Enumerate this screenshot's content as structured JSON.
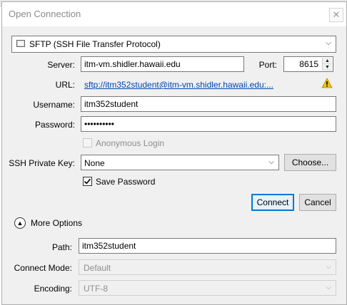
{
  "dialog": {
    "title": "Open Connection",
    "close_glyph": "✕"
  },
  "protocol": {
    "selected": "SFTP (SSH File Transfer Protocol)",
    "icon": "network-drive-icon"
  },
  "server": {
    "label": "Server:",
    "value": "itm-vm.shidler.hawaii.edu"
  },
  "port": {
    "label": "Port:",
    "value": "8615"
  },
  "url": {
    "label": "URL:",
    "value": "sftp://itm352student@itm-vm.shidler.hawaii.edu:...",
    "warning_icon": "warning-icon"
  },
  "username": {
    "label": "Username:",
    "value": "itm352student"
  },
  "password": {
    "label": "Password:",
    "value": "••••••••••"
  },
  "anonymous": {
    "label": "Anonymous Login",
    "checked": false,
    "enabled": false
  },
  "ssh_key": {
    "label": "SSH Private Key:",
    "selected": "None",
    "choose_label": "Choose..."
  },
  "save_password": {
    "label": "Save Password",
    "checked": true
  },
  "buttons": {
    "connect": "Connect",
    "cancel": "Cancel"
  },
  "more_options": {
    "label": "More Options",
    "expanded": true
  },
  "path": {
    "label": "Path:",
    "value": "itm352student"
  },
  "connect_mode": {
    "label": "Connect Mode:",
    "selected": "Default"
  },
  "encoding": {
    "label": "Encoding:",
    "selected": "UTF-8"
  },
  "colors": {
    "accent": "#0078d7",
    "link": "#0046b4",
    "warning": "#f2c200"
  }
}
